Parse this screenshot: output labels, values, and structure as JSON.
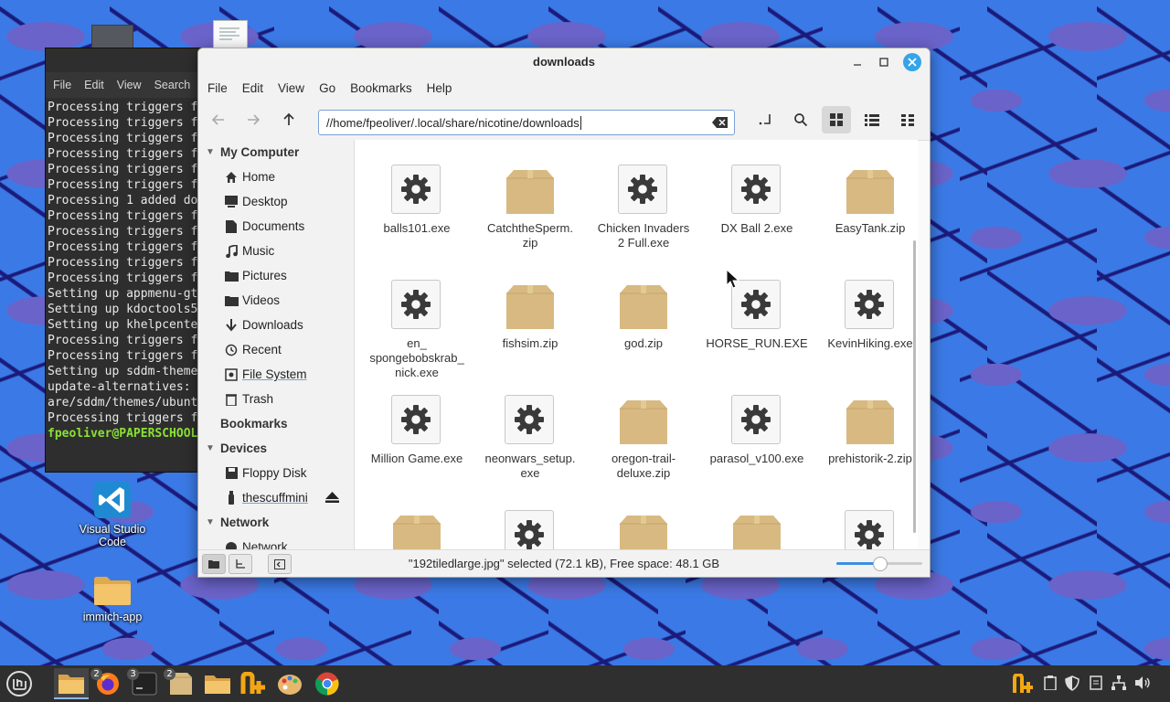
{
  "terminal": {
    "menu": [
      "File",
      "Edit",
      "View",
      "Search"
    ],
    "lines": [
      "Processing triggers f",
      "Processing triggers f",
      "Processing triggers f",
      "Processing triggers f",
      "Processing triggers f",
      "Processing triggers f",
      "Processing 1 added do",
      "Processing triggers f",
      "Processing triggers f",
      "Processing triggers f",
      "Processing triggers f",
      "Processing triggers f",
      "Setting up appmenu-gt",
      "Setting up kdoctools5",
      "Setting up khelpcente",
      "Processing triggers f",
      "Processing triggers f",
      "Setting up sddm-theme",
      "update-alternatives: ",
      "are/sddm/themes/ubunt",
      "Processing triggers f"
    ],
    "prompt": "fpeoliver@PAPERSCHOOL"
  },
  "desktop": {
    "icons": [
      {
        "label": "Visual Studio Code",
        "icon": "vscode-icon"
      },
      {
        "label": "immich-app",
        "icon": "folder-icon"
      }
    ]
  },
  "window": {
    "title": "downloads",
    "menu": [
      "File",
      "Edit",
      "View",
      "Go",
      "Bookmarks",
      "Help"
    ],
    "location": "//home/fpeoliver/.local/share/nicotine/downloads"
  },
  "sidebar": {
    "my_computer": "My Computer",
    "items": [
      {
        "label": "Home",
        "icon": "home-icon"
      },
      {
        "label": "Desktop",
        "icon": "desktop-icon"
      },
      {
        "label": "Documents",
        "icon": "documents-icon"
      },
      {
        "label": "Music",
        "icon": "music-icon"
      },
      {
        "label": "Pictures",
        "icon": "pictures-icon"
      },
      {
        "label": "Videos",
        "icon": "videos-icon"
      },
      {
        "label": "Downloads",
        "icon": "downloads-icon"
      },
      {
        "label": "Recent",
        "icon": "recent-icon"
      },
      {
        "label": "File System",
        "icon": "filesystem-icon"
      },
      {
        "label": "Trash",
        "icon": "trash-icon"
      }
    ],
    "bookmarks": "Bookmarks",
    "devices": "Devices",
    "device_items": [
      {
        "label": "Floppy Disk",
        "icon": "floppy-icon"
      },
      {
        "label": "thescuffmini",
        "icon": "usb-icon"
      }
    ],
    "network": "Network",
    "network_items": [
      {
        "label": "Network",
        "icon": "network-icon"
      }
    ]
  },
  "files": [
    {
      "name": "balls101.exe",
      "type": "exe"
    },
    {
      "name": "CatchtheSperm.\nzip",
      "type": "zip"
    },
    {
      "name": "Chicken Invaders\n2 Full.exe",
      "type": "exe"
    },
    {
      "name": "DX Ball 2.exe",
      "type": "exe"
    },
    {
      "name": "EasyTank.zip",
      "type": "zip"
    },
    {
      "name": "en_\nspongebobskrab_\nnick.exe",
      "type": "exe"
    },
    {
      "name": "fishsim.zip",
      "type": "zip"
    },
    {
      "name": "god.zip",
      "type": "zip"
    },
    {
      "name": "HORSE_RUN.EXE",
      "type": "exe"
    },
    {
      "name": "KevinHiking.exe",
      "type": "exe"
    },
    {
      "name": "Million Game.exe",
      "type": "exe"
    },
    {
      "name": "neonwars_setup.\nexe",
      "type": "exe"
    },
    {
      "name": "oregon-trail-\ndeluxe.zip",
      "type": "zip"
    },
    {
      "name": "parasol_v100.exe",
      "type": "exe"
    },
    {
      "name": "prehistorik-2.zip",
      "type": "zip"
    },
    {
      "name": "",
      "type": "zip"
    },
    {
      "name": "",
      "type": "exe"
    },
    {
      "name": "",
      "type": "zip"
    },
    {
      "name": "",
      "type": "zip"
    },
    {
      "name": "",
      "type": "exe"
    }
  ],
  "status": {
    "text": "\"192tiledlarge.jpg\" selected (72.1 kB), Free space: 48.1 GB",
    "zoom_level": 0.5
  },
  "taskbar": {
    "items": [
      {
        "icon": "menu-icon",
        "badge": ""
      },
      {
        "icon": "files-icon",
        "badge": ""
      },
      {
        "icon": "firefox-icon",
        "badge": "2"
      },
      {
        "icon": "terminal-icon",
        "badge": "3"
      },
      {
        "icon": "archive-icon",
        "badge": "2"
      },
      {
        "icon": "folder-icon",
        "badge": ""
      },
      {
        "icon": "nicotine-icon",
        "badge": ""
      },
      {
        "icon": "paint-icon",
        "badge": ""
      },
      {
        "icon": "chrome-icon",
        "badge": ""
      }
    ],
    "tray": [
      "nicotine-tray-icon",
      "clipboard-icon",
      "shield-icon",
      "notes-icon",
      "network-icon",
      "volume-icon"
    ]
  },
  "colors": {
    "accent": "#3d8fe0",
    "close_button": "#35a4e8",
    "zip_box": "#d7b981",
    "prompt": "#8ae234"
  }
}
